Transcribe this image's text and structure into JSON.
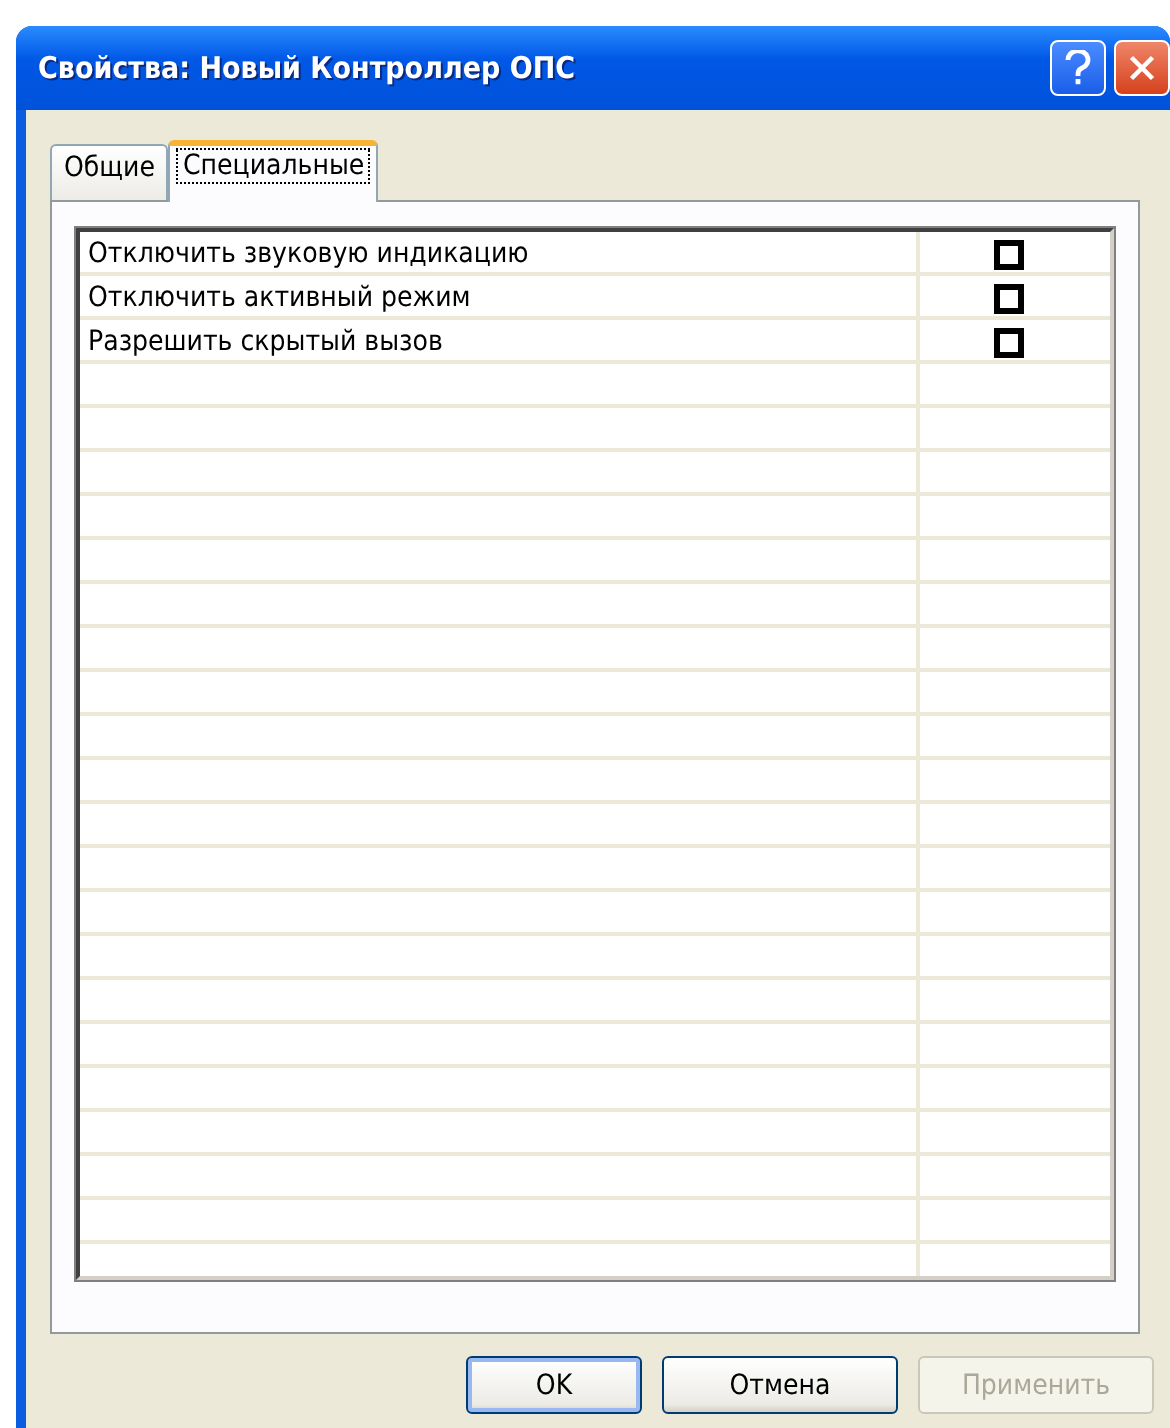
{
  "window": {
    "title": "Свойства: Новый Контроллер ОПС"
  },
  "tabs": [
    {
      "label": "Общие",
      "selected": false
    },
    {
      "label": "Специальные",
      "selected": true
    }
  ],
  "options": [
    {
      "label": "Отключить звуковую индикацию",
      "checked": false
    },
    {
      "label": "Отключить активный режим",
      "checked": false
    },
    {
      "label": "Разрешить скрытый вызов",
      "checked": false
    }
  ],
  "buttons": [
    {
      "label": "OK",
      "default": true,
      "disabled": false
    },
    {
      "label": "Отмена",
      "default": false,
      "disabled": false
    },
    {
      "label": "Применить",
      "default": false,
      "disabled": true
    }
  ]
}
